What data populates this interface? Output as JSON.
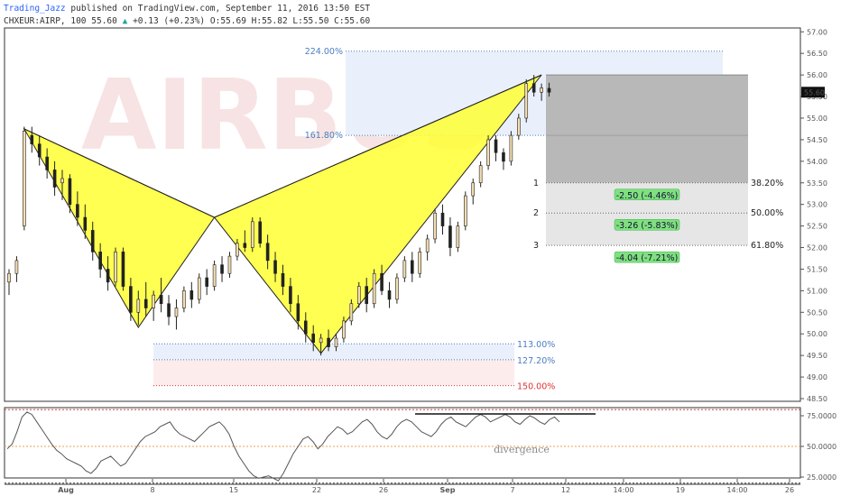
{
  "header": {
    "author": "Trading_Jazz",
    "published": "published on TradingView.com, September 11, 2016 13:50 EST",
    "symbol": "CHXEUR:AIRP, 100",
    "last": "55.60",
    "change": "+0.13 (+0.23%)",
    "ohlc": "O:55.69 H:55.82 L:55.50 C:55.60",
    "watermark": "AIRBUS"
  },
  "chart_data": {
    "type": "candlestick",
    "price_axis": {
      "min": 48.0,
      "max": 57.0,
      "ticks": [
        48.5,
        49.0,
        49.5,
        50.0,
        50.5,
        51.0,
        51.5,
        52.0,
        52.5,
        53.0,
        53.5,
        54.0,
        54.5,
        55.0,
        55.5,
        56.0,
        56.5,
        57.0
      ]
    },
    "last_price": 55.6,
    "time_axis_labels": [
      "Aug",
      "8",
      "15",
      "22",
      "26",
      "Sep",
      "7",
      "12",
      "14:00",
      "19",
      "14:00",
      "26"
    ],
    "candles": [
      [
        51.2,
        51.5,
        50.9,
        51.4
      ],
      [
        51.4,
        51.8,
        51.2,
        51.7
      ],
      [
        52.5,
        54.8,
        52.4,
        54.7
      ],
      [
        54.6,
        54.8,
        54.2,
        54.4
      ],
      [
        54.4,
        54.6,
        53.9,
        54.1
      ],
      [
        54.1,
        54.3,
        53.6,
        53.8
      ],
      [
        53.8,
        54.0,
        53.2,
        53.4
      ],
      [
        53.5,
        53.8,
        53.1,
        53.6
      ],
      [
        53.6,
        53.7,
        52.8,
        53.0
      ],
      [
        53.0,
        53.3,
        52.5,
        52.7
      ],
      [
        52.7,
        53.0,
        52.2,
        52.4
      ],
      [
        52.4,
        52.6,
        51.7,
        51.9
      ],
      [
        51.9,
        52.1,
        51.3,
        51.5
      ],
      [
        51.5,
        51.8,
        51.0,
        51.2
      ],
      [
        51.2,
        52.0,
        51.1,
        51.9
      ],
      [
        51.9,
        52.0,
        51.0,
        51.1
      ],
      [
        51.1,
        51.3,
        50.3,
        50.5
      ],
      [
        50.5,
        51.0,
        50.2,
        50.8
      ],
      [
        50.8,
        51.2,
        50.4,
        50.6
      ],
      [
        50.6,
        51.0,
        50.3,
        50.9
      ],
      [
        50.9,
        51.3,
        50.5,
        50.7
      ],
      [
        50.7,
        50.9,
        50.2,
        50.4
      ],
      [
        50.4,
        50.8,
        50.1,
        50.6
      ],
      [
        50.6,
        51.1,
        50.5,
        51.0
      ],
      [
        51.0,
        51.2,
        50.6,
        50.8
      ],
      [
        50.8,
        51.4,
        50.7,
        51.3
      ],
      [
        51.3,
        51.5,
        50.9,
        51.1
      ],
      [
        51.1,
        51.7,
        51.0,
        51.6
      ],
      [
        51.6,
        51.8,
        51.2,
        51.4
      ],
      [
        51.4,
        51.9,
        51.3,
        51.8
      ],
      [
        51.8,
        52.2,
        51.7,
        52.1
      ],
      [
        52.1,
        52.4,
        51.9,
        52.0
      ],
      [
        52.0,
        52.7,
        51.9,
        52.6
      ],
      [
        52.6,
        52.7,
        52.0,
        52.1
      ],
      [
        52.1,
        52.3,
        51.5,
        51.7
      ],
      [
        51.7,
        51.9,
        51.2,
        51.4
      ],
      [
        51.4,
        51.6,
        50.9,
        51.1
      ],
      [
        51.1,
        51.3,
        50.5,
        50.7
      ],
      [
        50.7,
        50.9,
        50.1,
        50.3
      ],
      [
        50.3,
        50.5,
        49.8,
        50.0
      ],
      [
        50.0,
        50.2,
        49.6,
        49.8
      ],
      [
        49.8,
        50.0,
        49.5,
        49.9
      ],
      [
        49.9,
        50.1,
        49.6,
        49.7
      ],
      [
        49.7,
        50.0,
        49.6,
        49.9
      ],
      [
        49.9,
        50.4,
        49.8,
        50.3
      ],
      [
        50.3,
        50.8,
        50.2,
        50.7
      ],
      [
        50.7,
        51.2,
        50.6,
        51.1
      ],
      [
        51.1,
        51.3,
        50.5,
        50.7
      ],
      [
        50.7,
        51.5,
        50.6,
        51.4
      ],
      [
        51.4,
        51.6,
        50.9,
        51.0
      ],
      [
        51.0,
        51.2,
        50.6,
        50.8
      ],
      [
        50.8,
        51.4,
        50.7,
        51.3
      ],
      [
        51.3,
        51.8,
        51.2,
        51.7
      ],
      [
        51.7,
        51.9,
        51.2,
        51.4
      ],
      [
        51.4,
        52.0,
        51.3,
        51.9
      ],
      [
        51.9,
        52.3,
        51.7,
        52.2
      ],
      [
        52.2,
        52.9,
        52.1,
        52.8
      ],
      [
        52.8,
        53.0,
        52.3,
        52.5
      ],
      [
        52.5,
        52.7,
        51.8,
        52.0
      ],
      [
        52.0,
        52.6,
        51.9,
        52.5
      ],
      [
        52.5,
        53.3,
        52.4,
        53.2
      ],
      [
        53.2,
        53.6,
        53.0,
        53.5
      ],
      [
        53.5,
        54.0,
        53.4,
        53.9
      ],
      [
        53.9,
        54.6,
        53.8,
        54.5
      ],
      [
        54.5,
        54.6,
        54.0,
        54.2
      ],
      [
        54.2,
        54.3,
        53.8,
        54.0
      ],
      [
        54.0,
        54.7,
        53.9,
        54.6
      ],
      [
        54.6,
        55.1,
        54.5,
        55.0
      ],
      [
        55.0,
        55.9,
        54.9,
        55.8
      ],
      [
        55.8,
        56.0,
        55.5,
        55.6
      ],
      [
        55.6,
        55.8,
        55.4,
        55.7
      ],
      [
        55.69,
        55.82,
        55.5,
        55.6
      ]
    ],
    "harmonic_pattern": {
      "points": [
        {
          "bar": 2,
          "price": 54.75
        },
        {
          "bar": 17,
          "price": 50.15
        },
        {
          "bar": 27,
          "price": 52.7
        },
        {
          "bar": 41,
          "price": 49.55
        },
        {
          "bar": 70,
          "price": 56.0
        }
      ]
    },
    "fib_levels": [
      {
        "label": "224.00%",
        "price": 56.55
      },
      {
        "label": "161.80%",
        "price": 54.6
      },
      {
        "label": "113.00%",
        "price": 49.77
      },
      {
        "label": "127.20%",
        "price": 49.4
      },
      {
        "label": "150.00%",
        "price": 48.8
      }
    ],
    "targets": [
      {
        "num": "1",
        "pct": "38.20%",
        "price": 53.5,
        "box": "-2.50 (-4.46%)"
      },
      {
        "num": "2",
        "pct": "50.00%",
        "price": 52.8,
        "box": "-3.26 (-5.83%)"
      },
      {
        "num": "3",
        "pct": "61.80%",
        "price": 52.05,
        "box": "-4.04 (-7.21%)"
      }
    ],
    "rsi": {
      "ticks": [
        25.0,
        50.0,
        75.0
      ],
      "tick_labels": [
        "25.0000",
        "50.0000",
        "75.0000"
      ],
      "overbought": 80,
      "oversold": 20,
      "values": [
        48,
        52,
        62,
        74,
        78,
        76,
        70,
        64,
        58,
        52,
        47,
        44,
        40,
        38,
        36,
        34,
        30,
        28,
        32,
        38,
        40,
        42,
        38,
        34,
        36,
        42,
        48,
        54,
        58,
        60,
        62,
        66,
        68,
        70,
        64,
        60,
        58,
        56,
        54,
        58,
        62,
        66,
        68,
        70,
        66,
        60,
        50,
        42,
        36,
        30,
        26,
        24,
        25,
        26,
        24,
        22,
        28,
        36,
        44,
        50,
        56,
        58,
        54,
        48,
        52,
        58,
        62,
        66,
        64,
        60,
        62,
        66,
        70,
        72,
        68,
        62,
        58,
        56,
        60,
        66,
        70,
        72,
        70,
        66,
        62,
        60,
        58,
        62,
        68,
        72,
        74,
        70,
        68,
        66,
        70,
        74,
        76,
        74,
        70,
        72,
        74,
        76,
        74,
        70,
        68,
        72,
        75,
        73,
        70,
        68,
        72,
        74,
        70
      ],
      "annotation": "divergence"
    }
  }
}
